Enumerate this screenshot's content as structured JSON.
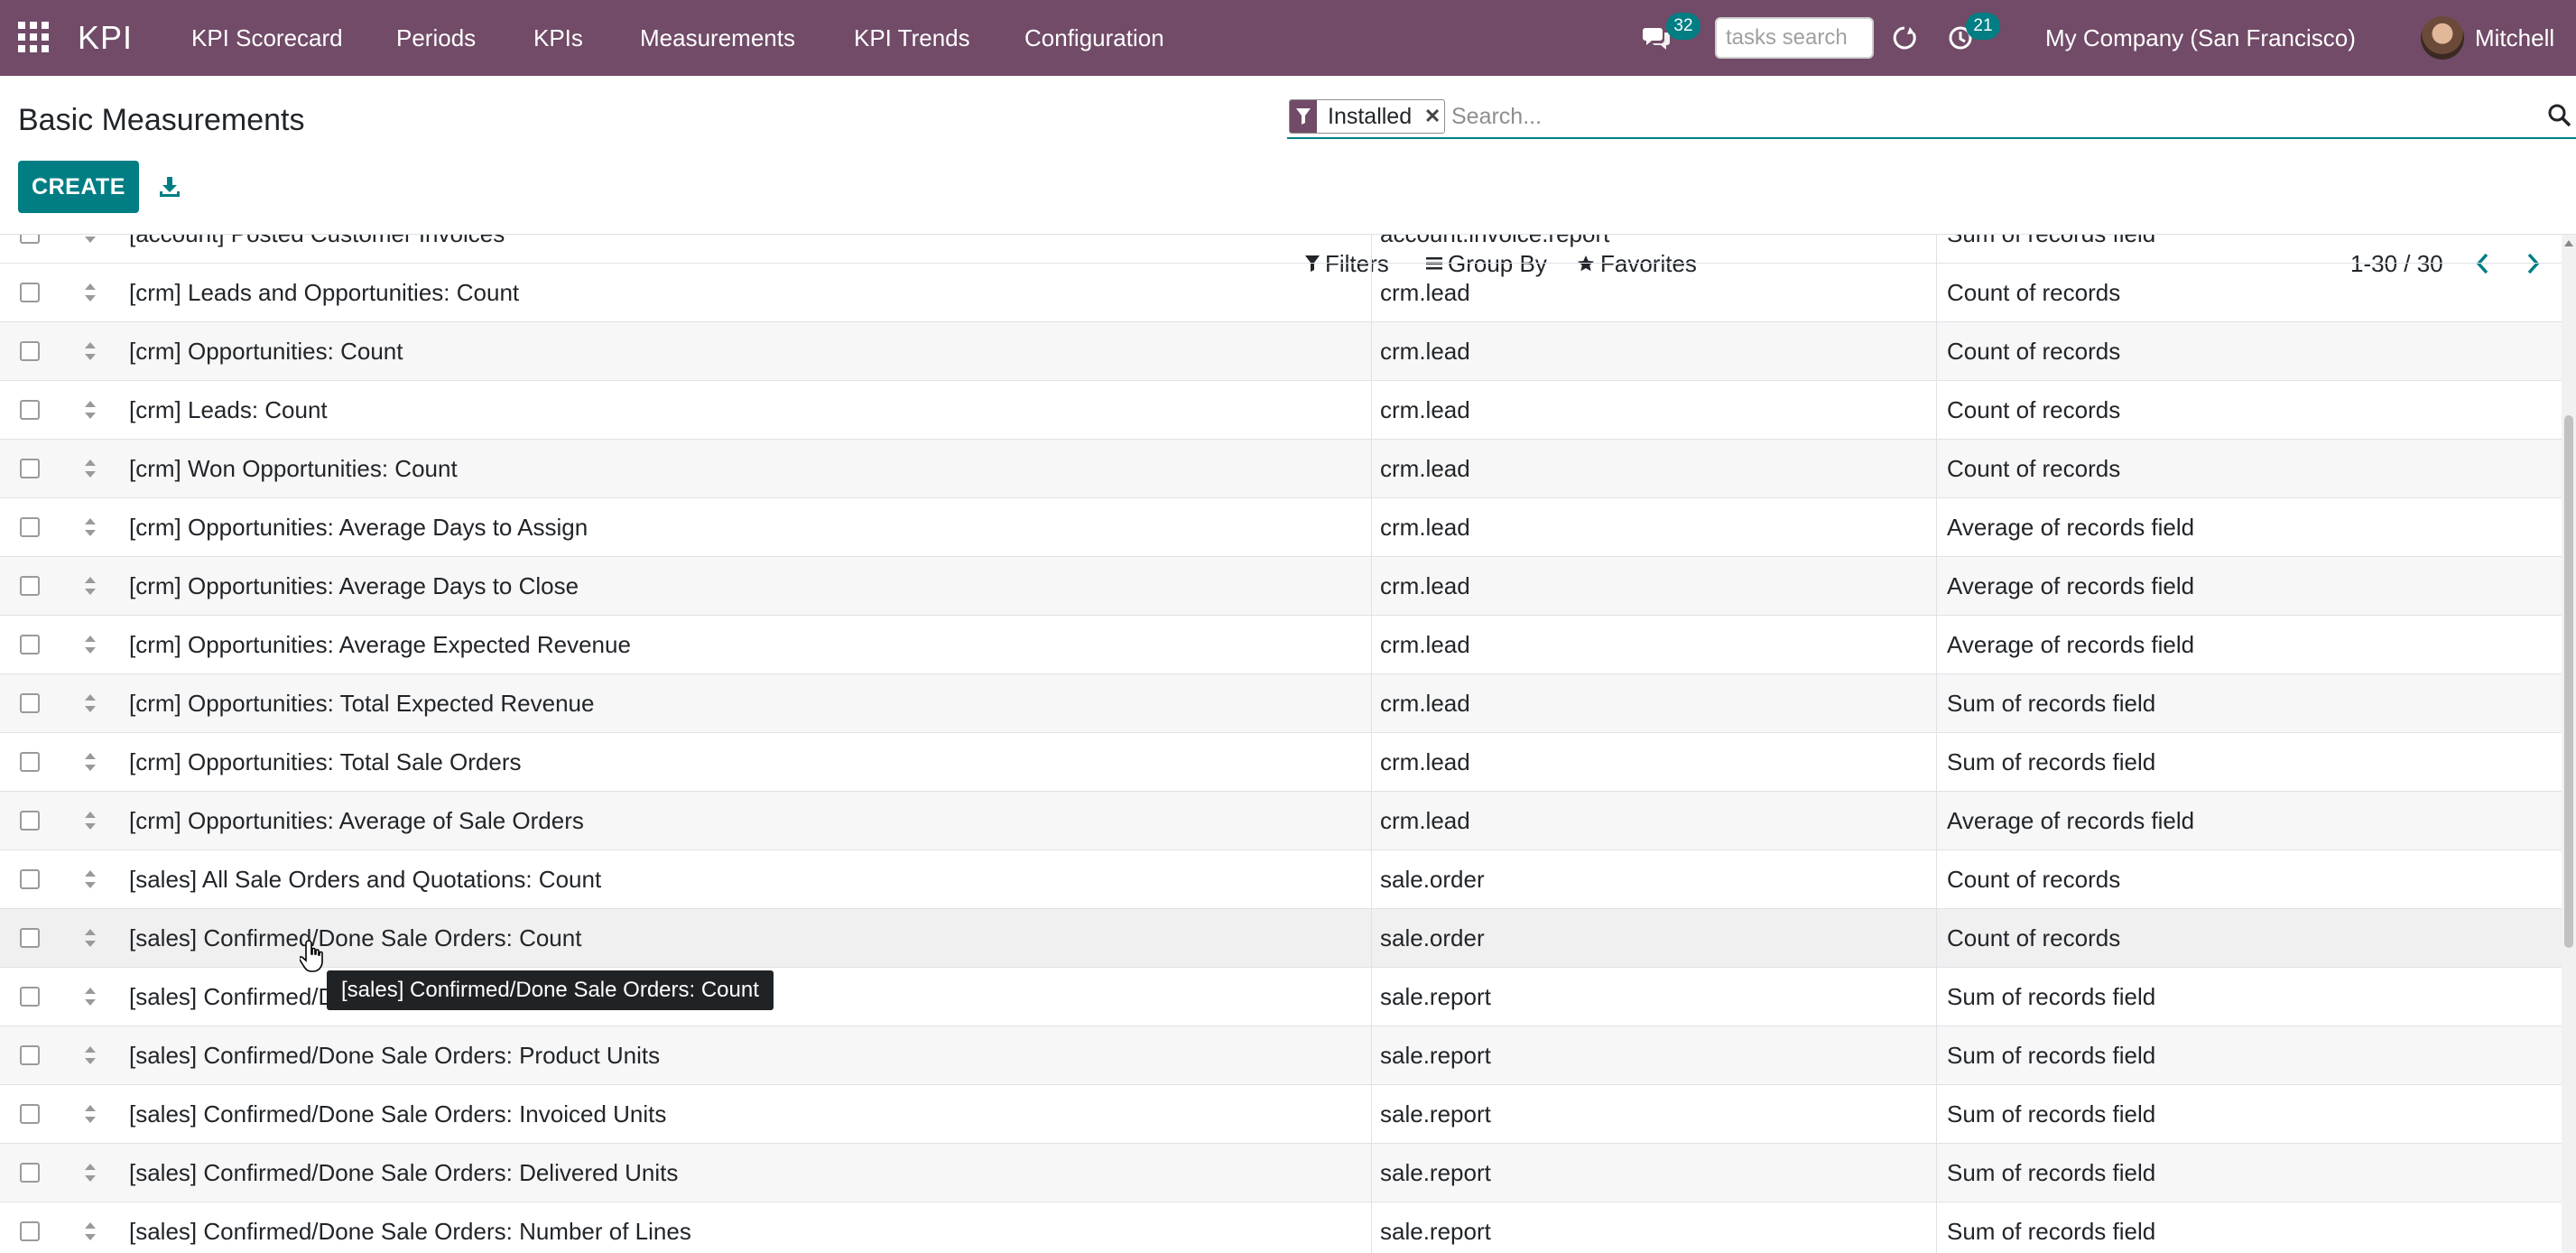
{
  "app": {
    "brand": "KPI",
    "menu": [
      "KPI Scorecard",
      "Periods",
      "KPIs",
      "Measurements",
      "KPI Trends",
      "Configuration"
    ],
    "messages_count": "32",
    "activities_count": "21",
    "tasks_search_placeholder": "tasks search",
    "company": "My Company (San Francisco)",
    "user": "Mitchell"
  },
  "control_panel": {
    "title": "Basic Measurements",
    "create_label": "CREATE",
    "facet_label": "Installed",
    "search_placeholder": "Search...",
    "filters_label": "Filters",
    "group_by_label": "Group By",
    "favorites_label": "Favorites",
    "pager": "1-30 / 30"
  },
  "colors": {
    "brand": "#714b67",
    "accent": "#017e84"
  },
  "table": {
    "partial_top_row": {
      "name": "[account] Posted Customer Invoices",
      "model": "account.invoice.report",
      "type": "Sum of records field"
    },
    "rows": [
      {
        "name": "[crm] Leads and Opportunities: Count",
        "model": "crm.lead",
        "type": "Count of records"
      },
      {
        "name": "[crm] Opportunities: Count",
        "model": "crm.lead",
        "type": "Count of records"
      },
      {
        "name": "[crm] Leads: Count",
        "model": "crm.lead",
        "type": "Count of records"
      },
      {
        "name": "[crm] Won Opportunities: Count",
        "model": "crm.lead",
        "type": "Count of records"
      },
      {
        "name": "[crm] Opportunities: Average Days to Assign",
        "model": "crm.lead",
        "type": "Average of records field"
      },
      {
        "name": "[crm] Opportunities: Average Days to Close",
        "model": "crm.lead",
        "type": "Average of records field"
      },
      {
        "name": "[crm] Opportunities: Average Expected Revenue",
        "model": "crm.lead",
        "type": "Average of records field"
      },
      {
        "name": "[crm] Opportunities: Total Expected Revenue",
        "model": "crm.lead",
        "type": "Sum of records field"
      },
      {
        "name": "[crm] Opportunities: Total Sale Orders",
        "model": "crm.lead",
        "type": "Sum of records field"
      },
      {
        "name": "[crm] Opportunities: Average of Sale Orders",
        "model": "crm.lead",
        "type": "Average of records field"
      },
      {
        "name": "[sales] All Sale Orders and Quotations: Count",
        "model": "sale.order",
        "type": "Count of records"
      },
      {
        "name": "[sales] Confirmed/Done Sale Orders: Count",
        "model": "sale.order",
        "type": "Count of records"
      },
      {
        "name": "[sales] Confirmed/D",
        "model": "sale.report",
        "type": "Sum of records field"
      },
      {
        "name": "[sales] Confirmed/Done Sale Orders: Product Units",
        "model": "sale.report",
        "type": "Sum of records field"
      },
      {
        "name": "[sales] Confirmed/Done Sale Orders: Invoiced Units",
        "model": "sale.report",
        "type": "Sum of records field"
      },
      {
        "name": "[sales] Confirmed/Done Sale Orders: Delivered Units",
        "model": "sale.report",
        "type": "Sum of records field"
      },
      {
        "name": "[sales] Confirmed/Done Sale Orders: Number of Lines",
        "model": "sale.report",
        "type": "Sum of records field"
      }
    ]
  },
  "tooltip": {
    "text": "[sales] Confirmed/Done Sale Orders: Count"
  }
}
